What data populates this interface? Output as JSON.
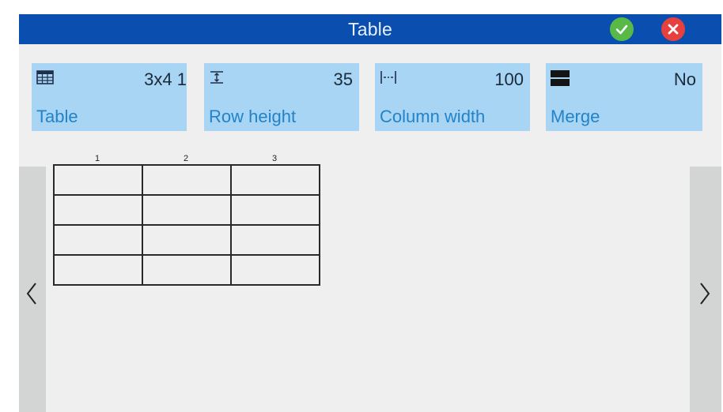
{
  "header": {
    "title": "Table"
  },
  "settings": {
    "table": {
      "label": "Table",
      "value": "3x4 1",
      "icon": "table-grid-icon"
    },
    "row_height": {
      "label": "Row height",
      "value": "35",
      "icon": "row-height-icon"
    },
    "column_width": {
      "label": "Column width",
      "value": "100",
      "icon": "column-width-icon"
    },
    "merge": {
      "label": "Merge",
      "value": "No",
      "icon": "merge-cells-icon"
    }
  },
  "grid": {
    "column_numbers": [
      "1",
      "2",
      "3"
    ],
    "columns": 3,
    "rows": 4
  },
  "colors": {
    "titlebar": "#0a4eb0",
    "setting_bg": "#a8d5f4",
    "label_text": "#2283c9",
    "ok": "#58b947",
    "cancel": "#e6403f"
  }
}
